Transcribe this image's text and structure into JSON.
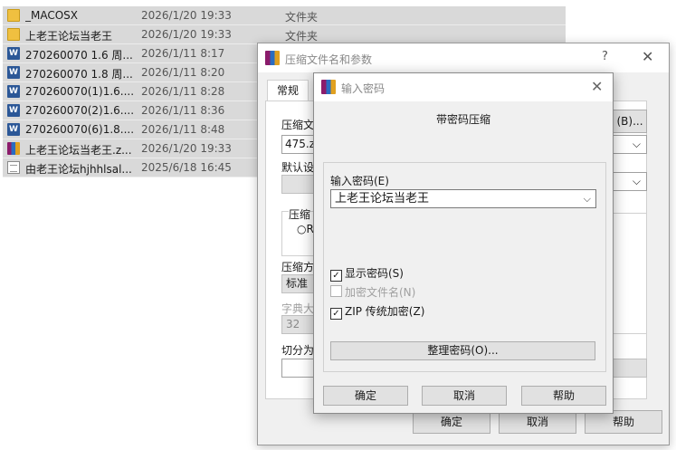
{
  "file_list": {
    "rows": [
      {
        "icon": "folder-icon",
        "name": "_MACOSX",
        "date": "2026/1/20 19:33",
        "type": "文件夹"
      },
      {
        "icon": "folder-icon",
        "name": "上老王论坛当老王",
        "date": "2026/1/20 19:33",
        "type": "文件夹"
      },
      {
        "icon": "word-doc-icon",
        "name": "270260070 1.6 周...",
        "date": "2026/1/11 8:17",
        "type": ""
      },
      {
        "icon": "word-doc-icon",
        "name": "270260070 1.8 周...",
        "date": "2026/1/11 8:20",
        "type": ""
      },
      {
        "icon": "word-doc-icon",
        "name": "270260070(1)1.6....",
        "date": "2026/1/11 8:28",
        "type": ""
      },
      {
        "icon": "word-doc-icon",
        "name": "270260070(2)1.6....",
        "date": "2026/1/11 8:36",
        "type": ""
      },
      {
        "icon": "word-doc-icon",
        "name": "270260070(6)1.8....",
        "date": "2026/1/11 8:48",
        "type": ""
      },
      {
        "icon": "winrar-archive-icon",
        "name": "上老王论坛当老王.z...",
        "date": "2026/1/20 19:33",
        "type": ""
      },
      {
        "icon": "text-file-icon",
        "name": "由老王论坛hjhhlsal...",
        "date": "2025/6/18 16:45",
        "type": ""
      }
    ]
  },
  "archive_dialog": {
    "title": "压缩文件名和参数",
    "help_icon": "?",
    "close_icon": "✕",
    "tab_general": "常规",
    "archive_name_label": "压缩文",
    "archive_name_value": "475.zip",
    "browse_label": "(B)...",
    "default_profile_label": "默认设",
    "format_label": "压缩",
    "format_option_partial": "R",
    "method_label": "压缩方",
    "method_value": "标准",
    "dict_label": "字典大",
    "dict_value": "32",
    "split_label": "切分为",
    "ok_label": "确定",
    "cancel_label": "取消",
    "help_label": "帮助"
  },
  "password_dialog": {
    "title": "输入密码",
    "close_icon": "✕",
    "heading": "带密码压缩",
    "password_label": "输入密码(E)",
    "password_value": "上老王论坛当老王",
    "show_password": {
      "label": "显示密码(S)",
      "checked": true,
      "enabled": true
    },
    "encrypt_filenames": {
      "label": "加密文件名(N)",
      "checked": false,
      "enabled": false
    },
    "zip_legacy": {
      "label": "ZIP 传统加密(Z)",
      "checked": true,
      "enabled": true
    },
    "organize_label": "整理密码(O)...",
    "ok_label": "确定",
    "cancel_label": "取消",
    "help_label": "帮助"
  }
}
